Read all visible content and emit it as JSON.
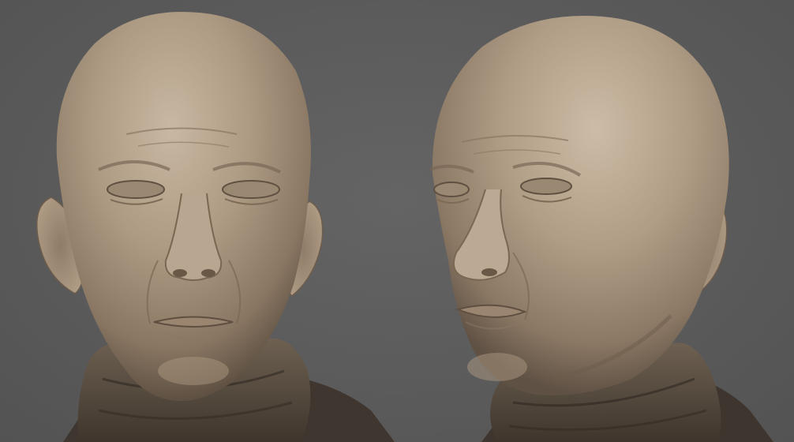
{
  "scene": {
    "description_free": true,
    "background_color": "#5c5c5c",
    "material_color": "#a8957f",
    "views": [
      {
        "id": "front",
        "icon": "sculpt-head-front-view"
      },
      {
        "id": "three-quarter",
        "icon": "sculpt-head-three-quarter-view"
      }
    ]
  }
}
